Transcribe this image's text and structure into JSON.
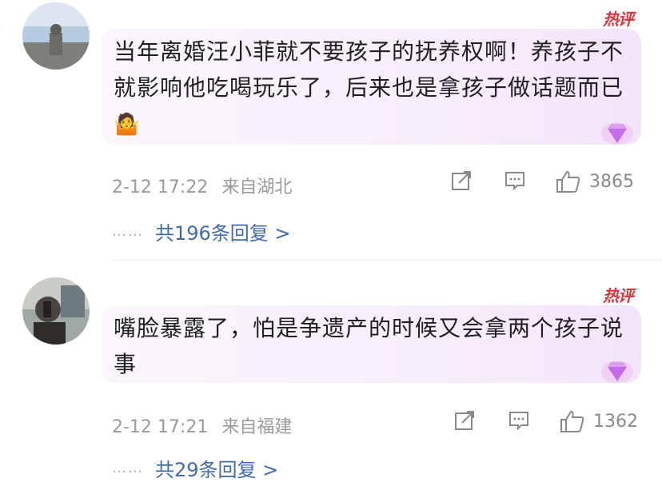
{
  "comments": [
    {
      "hot_badge": "热评",
      "text": "当年离婚汪小菲就不要孩子的抚养权啊！养孩子不就影响他吃喝玩乐了，后来也是拿孩子做话题而已",
      "emoji": "🤷",
      "date": "2-12 17:22",
      "location": "来自湖北",
      "likes": "3865",
      "replies_label": "共196条回复 >",
      "replies_dots": "……"
    },
    {
      "hot_badge": "热评",
      "text": "嘴脸暴露了，怕是争遗产的时候又会拿两个孩子说事",
      "date": "2-12 17:21",
      "location": "来自福建",
      "likes": "1362",
      "replies_label": "共29条回复 >",
      "replies_dots": "……"
    }
  ],
  "colors": {
    "hot": "#e0323a",
    "link": "#3c6bb3",
    "meta": "#9a9a9a",
    "bubble": "#f7eefb"
  }
}
